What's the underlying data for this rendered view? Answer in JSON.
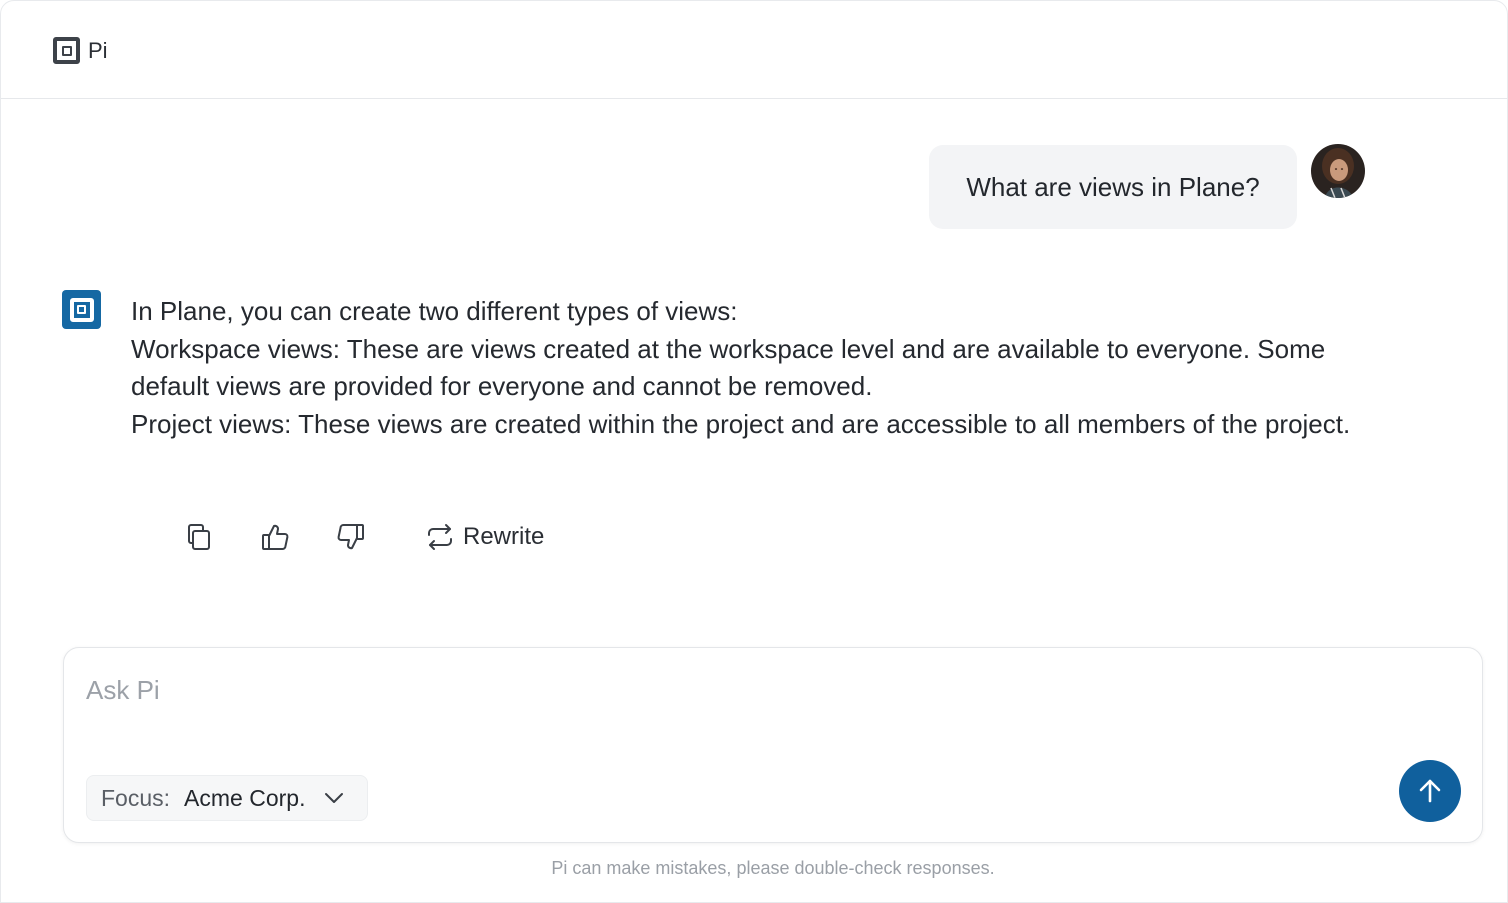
{
  "app": {
    "name": "Pi",
    "logo_icon": "square-logo-icon"
  },
  "colors": {
    "accent": "#1568a3",
    "send_button": "#10609d",
    "bubble_bg": "#f3f4f6"
  },
  "conversation": {
    "user_message": "What are views in Plane?",
    "assistant_paragraphs": [
      "In Plane, you can create two different types of views:",
      "Workspace views: These are views created at the workspace level and are available to everyone. Some default views are provided for everyone and cannot be removed.",
      "Project views: These views are created within the project and are accessible to all members of the project."
    ]
  },
  "actions": {
    "copy_icon": "copy-icon",
    "thumbs_up_icon": "thumbs-up-icon",
    "thumbs_down_icon": "thumbs-down-icon",
    "rewrite_icon": "repeat-icon",
    "rewrite_label": "Rewrite"
  },
  "composer": {
    "placeholder": "Ask Pi",
    "value": "",
    "focus_label": "Focus:",
    "focus_value": "Acme Corp.",
    "send_icon": "arrow-up-icon"
  },
  "footer": {
    "disclaimer": "Pi can make mistakes, please double-check responses."
  }
}
